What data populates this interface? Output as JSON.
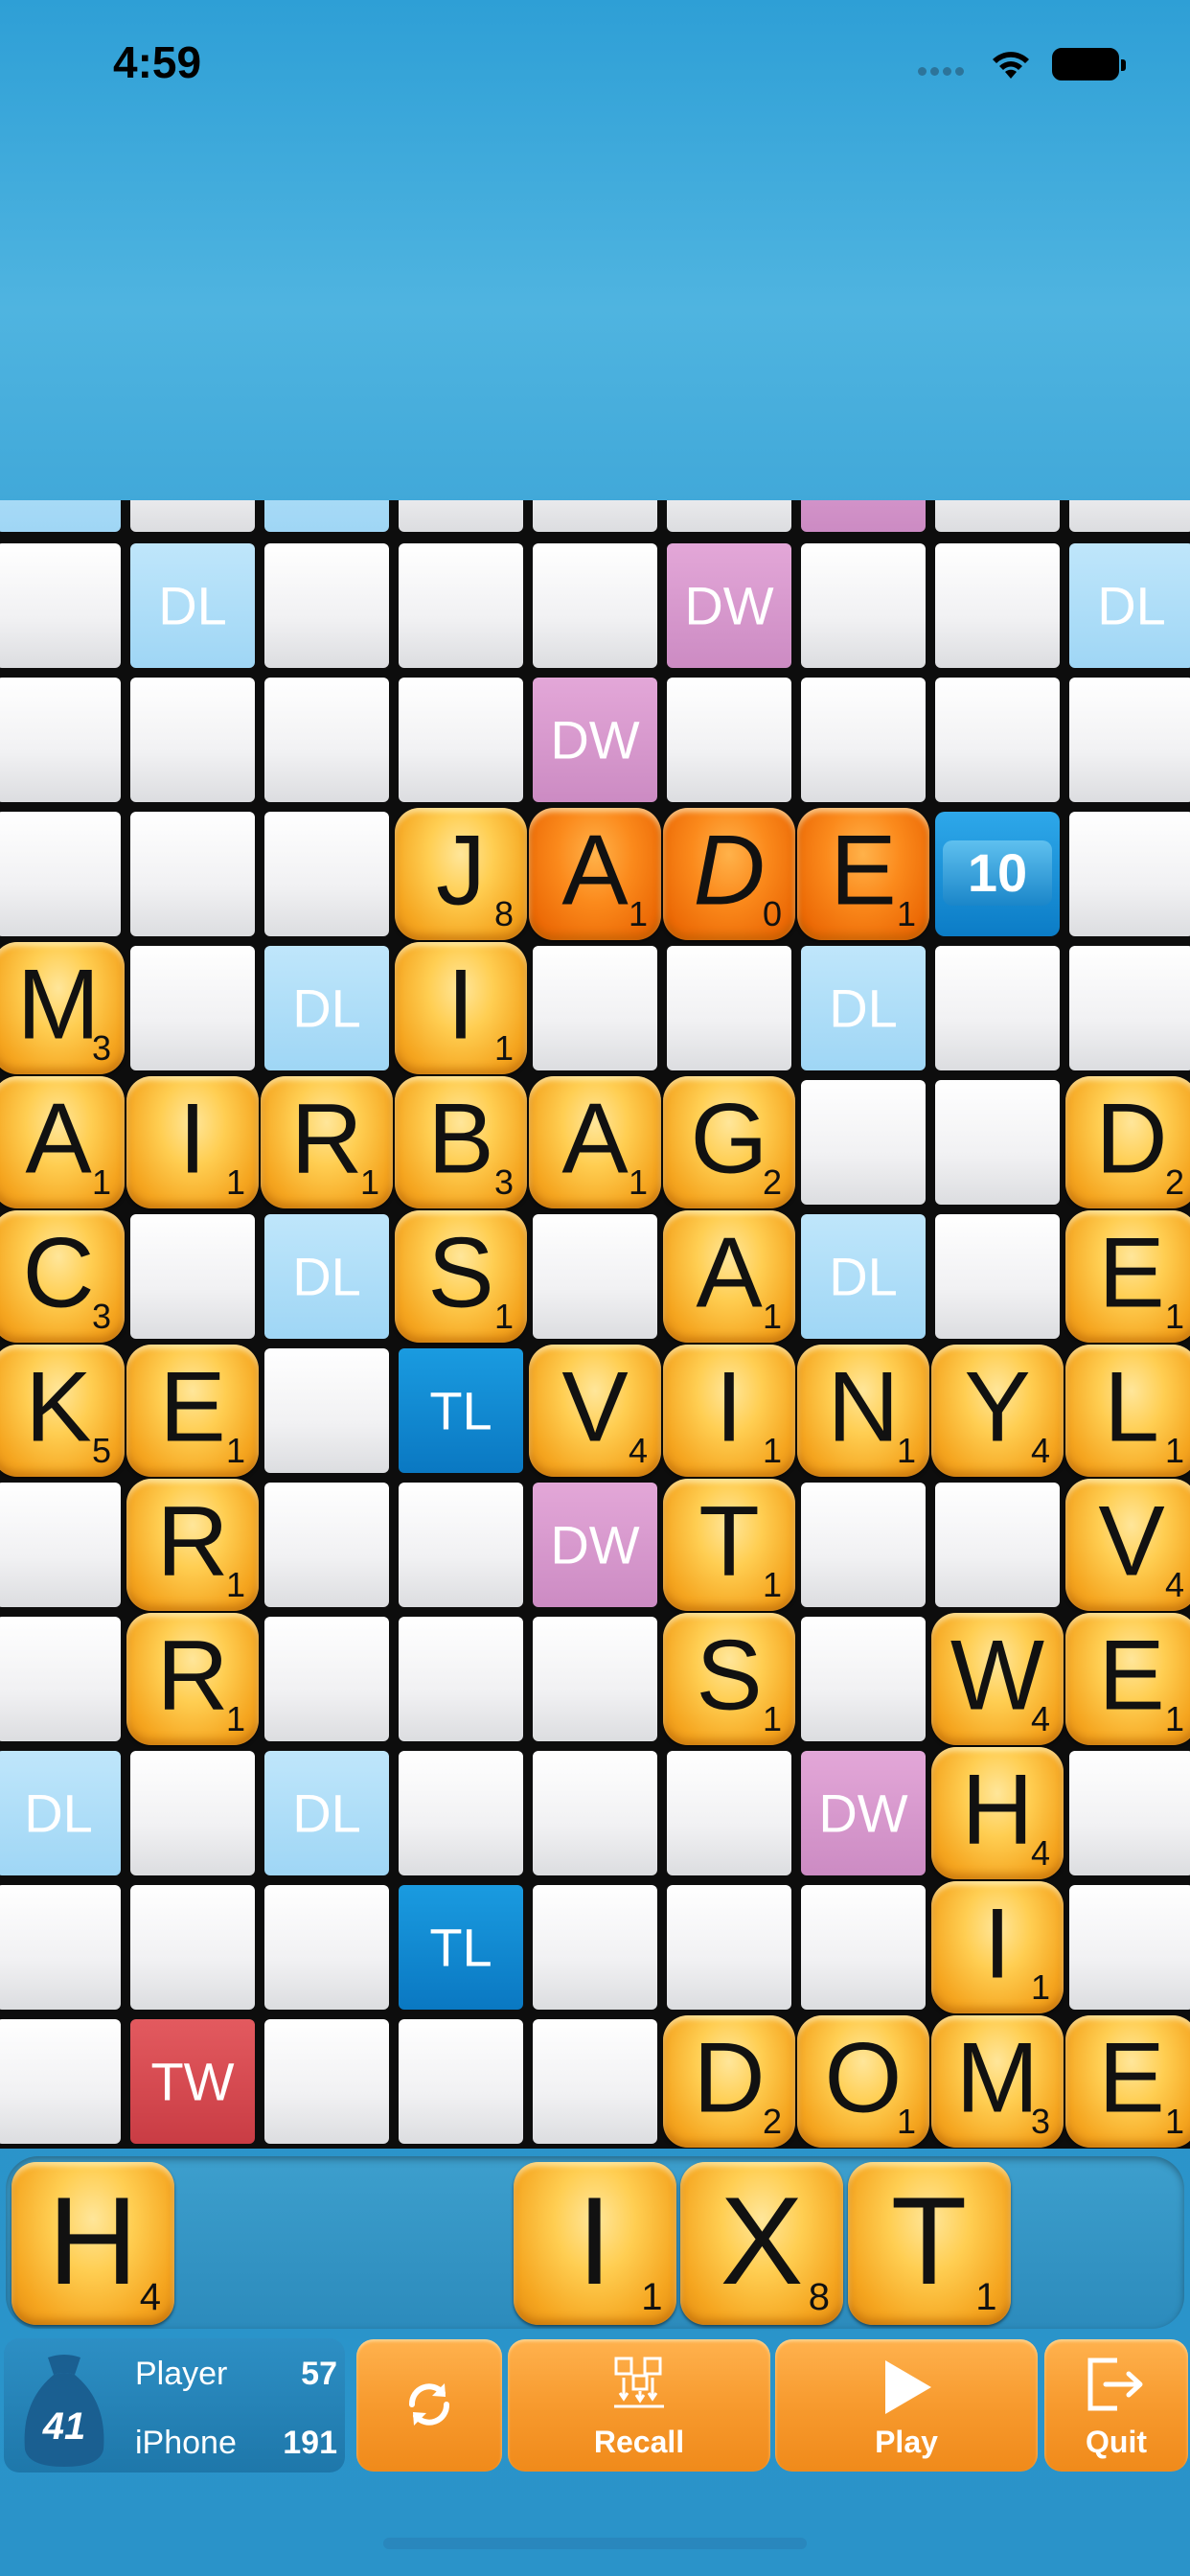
{
  "status_bar": {
    "time": "4:59"
  },
  "board": {
    "top_row_colors": [
      "dl",
      "plain",
      "dl",
      "plain",
      "plain",
      "plain",
      "dw",
      "plain",
      "plain"
    ],
    "rows": [
      [
        {
          "b": "plain"
        },
        {
          "b": "dl",
          "t": "DL"
        },
        {
          "b": "plain"
        },
        {
          "b": "plain"
        },
        {
          "b": "plain"
        },
        {
          "b": "dw",
          "t": "DW"
        },
        {
          "b": "plain"
        },
        {
          "b": "plain"
        },
        {
          "b": "dl",
          "t": "DL"
        }
      ],
      [
        {
          "b": "plain"
        },
        {
          "b": "plain"
        },
        {
          "b": "plain"
        },
        {
          "b": "plain"
        },
        {
          "b": "dw",
          "t": "DW"
        },
        {
          "b": "plain"
        },
        {
          "b": "plain"
        },
        {
          "b": "plain"
        },
        {
          "b": "plain"
        }
      ],
      [
        {
          "b": "plain"
        },
        {
          "b": "plain"
        },
        {
          "b": "plain"
        },
        {
          "l": "J",
          "p": "8"
        },
        {
          "l": "A",
          "p": "1",
          "hot": true
        },
        {
          "l": "D",
          "p": "0",
          "hot": true,
          "blank": true
        },
        {
          "l": "E",
          "p": "1",
          "hot": true
        },
        {
          "badge": "10"
        },
        {
          "b": "plain"
        }
      ],
      [
        {
          "l": "M",
          "p": "3"
        },
        {
          "b": "plain"
        },
        {
          "b": "dl",
          "t": "DL"
        },
        {
          "l": "I",
          "p": "1"
        },
        {
          "b": "plain"
        },
        {
          "b": "plain"
        },
        {
          "b": "dl",
          "t": "DL"
        },
        {
          "b": "plain"
        },
        {
          "b": "plain"
        }
      ],
      [
        {
          "l": "A",
          "p": "1"
        },
        {
          "l": "I",
          "p": "1"
        },
        {
          "l": "R",
          "p": "1"
        },
        {
          "l": "B",
          "p": "3"
        },
        {
          "l": "A",
          "p": "1"
        },
        {
          "l": "G",
          "p": "2"
        },
        {
          "b": "plain"
        },
        {
          "b": "plain"
        },
        {
          "l": "D",
          "p": "2"
        }
      ],
      [
        {
          "l": "C",
          "p": "3"
        },
        {
          "b": "plain"
        },
        {
          "b": "dl",
          "t": "DL"
        },
        {
          "l": "S",
          "p": "1"
        },
        {
          "b": "plain"
        },
        {
          "l": "A",
          "p": "1"
        },
        {
          "b": "dl",
          "t": "DL"
        },
        {
          "b": "plain"
        },
        {
          "l": "E",
          "p": "1"
        }
      ],
      [
        {
          "l": "K",
          "p": "5"
        },
        {
          "l": "E",
          "p": "1"
        },
        {
          "b": "plain"
        },
        {
          "b": "tl",
          "t": "TL"
        },
        {
          "l": "V",
          "p": "4"
        },
        {
          "l": "I",
          "p": "1"
        },
        {
          "l": "N",
          "p": "1"
        },
        {
          "l": "Y",
          "p": "4"
        },
        {
          "l": "L",
          "p": "1"
        }
      ],
      [
        {
          "b": "plain"
        },
        {
          "l": "R",
          "p": "1"
        },
        {
          "b": "plain"
        },
        {
          "b": "plain"
        },
        {
          "b": "dw",
          "t": "DW"
        },
        {
          "l": "T",
          "p": "1"
        },
        {
          "b": "plain"
        },
        {
          "b": "plain"
        },
        {
          "l": "V",
          "p": "4"
        }
      ],
      [
        {
          "b": "plain"
        },
        {
          "l": "R",
          "p": "1"
        },
        {
          "b": "plain"
        },
        {
          "b": "plain"
        },
        {
          "b": "plain"
        },
        {
          "l": "S",
          "p": "1"
        },
        {
          "b": "plain"
        },
        {
          "l": "W",
          "p": "4"
        },
        {
          "l": "E",
          "p": "1"
        }
      ],
      [
        {
          "b": "dl",
          "t": "DL"
        },
        {
          "b": "plain"
        },
        {
          "b": "dl",
          "t": "DL"
        },
        {
          "b": "plain"
        },
        {
          "b": "plain"
        },
        {
          "b": "plain"
        },
        {
          "b": "dw",
          "t": "DW"
        },
        {
          "l": "H",
          "p": "4"
        },
        {
          "b": "plain"
        }
      ],
      [
        {
          "b": "plain"
        },
        {
          "b": "plain"
        },
        {
          "b": "plain"
        },
        {
          "b": "tl",
          "t": "TL"
        },
        {
          "b": "plain"
        },
        {
          "b": "plain"
        },
        {
          "b": "plain"
        },
        {
          "l": "I",
          "p": "1"
        },
        {
          "b": "plain"
        }
      ],
      [
        {
          "b": "plain"
        },
        {
          "b": "tw",
          "t": "TW"
        },
        {
          "b": "plain"
        },
        {
          "b": "plain"
        },
        {
          "b": "plain"
        },
        {
          "l": "D",
          "p": "2"
        },
        {
          "l": "O",
          "p": "1"
        },
        {
          "l": "M",
          "p": "3"
        },
        {
          "l": "E",
          "p": "1"
        }
      ]
    ]
  },
  "rack": {
    "tiles": [
      {
        "l": "H",
        "p": "4",
        "slot": 1
      },
      {
        "l": "I",
        "p": "1",
        "slot": 4
      },
      {
        "l": "X",
        "p": "8",
        "slot": 5
      },
      {
        "l": "T",
        "p": "1",
        "slot": 6
      }
    ]
  },
  "scores": {
    "bag_count": "41",
    "player_label": "Player",
    "player_score": "57",
    "opponent_label": "iPhone",
    "opponent_score": "191"
  },
  "buttons": {
    "swap_icon": "refresh-icon",
    "recall": "Recall",
    "play": "Play",
    "quit": "Quit"
  },
  "colors": {
    "tile_gold": "#f5a51f",
    "tile_hot": "#ec6a06",
    "dl": "#9fd6f5",
    "tl": "#0a78c2",
    "dw": "#cc8bc3",
    "tw": "#c93c44",
    "button_orange": "#f79a2e",
    "background_blue": "#2d98cf"
  }
}
